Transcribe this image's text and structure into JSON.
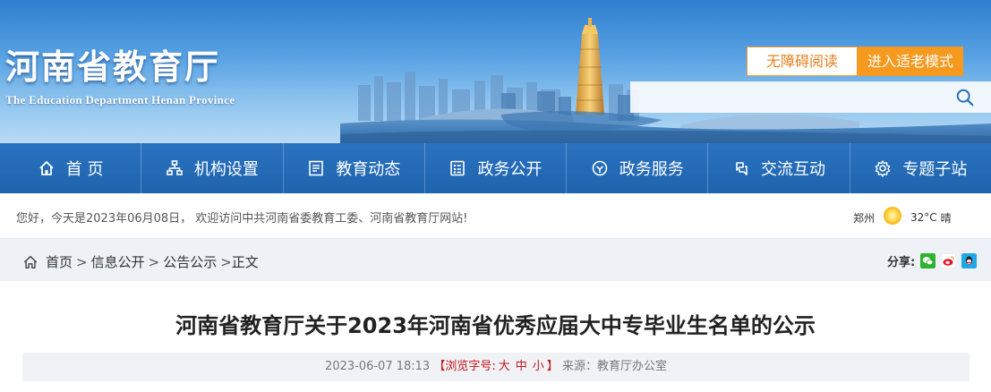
{
  "header": {
    "site_title": "河南省教育厅",
    "site_subtitle": "The Education Department Henan Province",
    "accessible_label": "无障碍阅读",
    "elder_mode_label": "进入适老模式",
    "search_placeholder": "",
    "colors": {
      "accessible": "#e6801c",
      "elder_bg": "#f5991f"
    }
  },
  "nav": {
    "items": [
      {
        "label": "首 页",
        "icon": "home-icon"
      },
      {
        "label": "机构设置",
        "icon": "org-chart-icon"
      },
      {
        "label": "教育动态",
        "icon": "news-icon"
      },
      {
        "label": "政务公开",
        "icon": "document-icon"
      },
      {
        "label": "政务服务",
        "icon": "service-icon"
      },
      {
        "label": "交流互动",
        "icon": "interaction-icon"
      },
      {
        "label": "专题子站",
        "icon": "gear-icon"
      }
    ],
    "color": "#1f63ad"
  },
  "welcome": {
    "text": "您好，今天是2023年06月08日， 欢迎访问中共河南省委教育工委、河南省教育厅网站!",
    "city": "郑州",
    "temperature": "32°C",
    "condition": "晴"
  },
  "breadcrumb": {
    "items": [
      "首页",
      "信息公开",
      "公告公示"
    ],
    "current": "正文",
    "separator": ">",
    "share_label": "分享:",
    "share_icons": [
      "wechat-icon",
      "weibo-icon",
      "qq-icon"
    ]
  },
  "article": {
    "title": "河南省教育厅关于2023年河南省优秀应届大中专毕业生名单的公示",
    "date": "2023-06-07 18:13",
    "font_size_label": "【浏览字号:",
    "font_sizes": [
      "大",
      "中",
      "小"
    ],
    "font_size_close": "】",
    "source": "来源：教育厅办公室"
  }
}
